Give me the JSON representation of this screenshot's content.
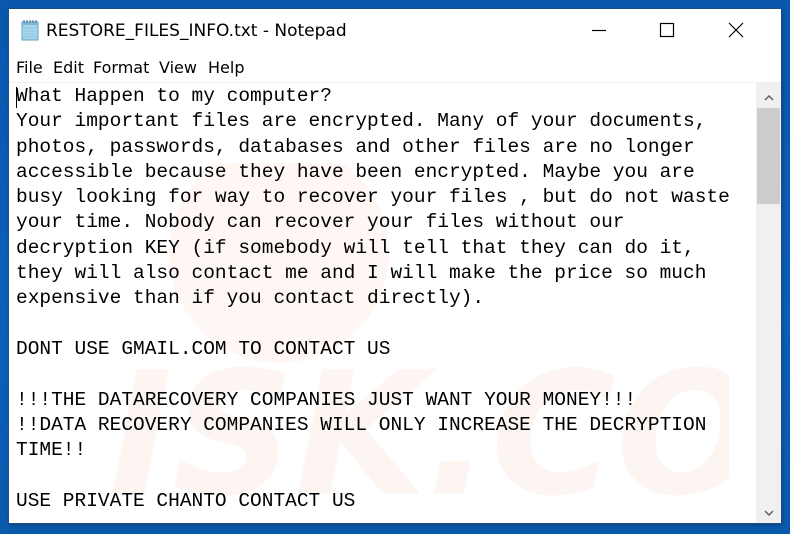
{
  "window": {
    "title": "RESTORE_FILES_INFO.txt - Notepad",
    "app_icon": "notepad-icon",
    "controls": {
      "minimize": "minimize-icon",
      "maximize": "maximize-icon",
      "close": "close-icon"
    }
  },
  "menu": {
    "items": [
      {
        "label": "File"
      },
      {
        "label": "Edit"
      },
      {
        "label": "Format"
      },
      {
        "label": "View"
      },
      {
        "label": "Help"
      }
    ]
  },
  "editor": {
    "lines": [
      "What Happen to my computer?",
      "Your important files are encrypted. Many of your documents,",
      "photos, passwords, databases and other files are no longer",
      "accessible because they have been encrypted. Maybe you are",
      "busy looking for way to recover your files , but do not waste",
      "your time. Nobody can recover your files without our",
      "decryption KEY (if somebody will tell that they can do it,",
      "they will also contact me and I will make the price so much",
      "expensive than if you contact directly).",
      "",
      "DONT USE GMAIL.COM TO CONTACT US",
      "",
      "!!!THE DATARECOVERY COMPANIES JUST WANT YOUR MONEY!!!",
      "!!DATA RECOVERY COMPANIES WILL ONLY INCREASE THE DECRYPTION",
      "TIME!!",
      "",
      "USE PRIVATE CHANTO CONTACT US"
    ]
  },
  "scrollbar": {
    "up_icon": "chevron-up-icon",
    "down_icon": "chevron-down-icon"
  },
  "colors": {
    "desktop": "#0b5cb3",
    "window_bg": "#ffffff",
    "scroll_track": "#f0f0f0",
    "scroll_thumb": "#cdcdcd",
    "text": "#000000"
  }
}
